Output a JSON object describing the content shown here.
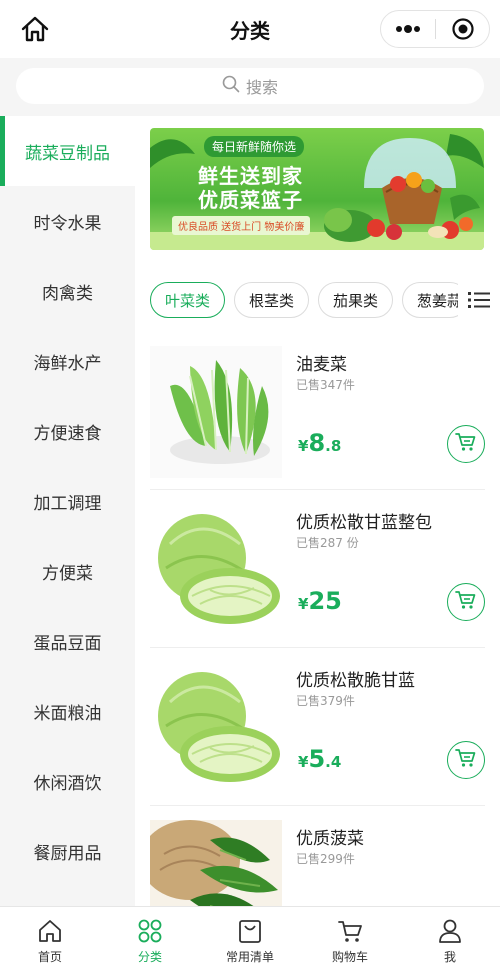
{
  "header": {
    "title": "分类"
  },
  "search": {
    "placeholder": "搜索"
  },
  "sidebar": {
    "items": [
      {
        "label": "蔬菜豆制品",
        "active": true
      },
      {
        "label": "时令水果"
      },
      {
        "label": "肉禽类"
      },
      {
        "label": "海鲜水产"
      },
      {
        "label": "方便速食"
      },
      {
        "label": "加工调理"
      },
      {
        "label": "方便菜"
      },
      {
        "label": "蛋品豆面"
      },
      {
        "label": "米面粮油"
      },
      {
        "label": "休闲酒饮"
      },
      {
        "label": "餐厨用品"
      }
    ]
  },
  "banner": {
    "tag": "每日新鲜随你选",
    "line1": "鲜生送到家",
    "line2": "优质菜篮子",
    "strip": "优良品质 送货上门 物美价廉"
  },
  "tabs": [
    {
      "label": "叶菜类",
      "active": true
    },
    {
      "label": "根茎类"
    },
    {
      "label": "茄果类"
    },
    {
      "label": "葱姜蒜"
    }
  ],
  "products": [
    {
      "name": "油麦菜",
      "sold": "已售347件",
      "yen": "¥",
      "price_int": "8",
      "price_dec": ".8"
    },
    {
      "name": "优质松散甘蓝整包",
      "sold": "已售287 份",
      "yen": "¥",
      "price_int": "25",
      "price_dec": ""
    },
    {
      "name": "优质松散脆甘蓝",
      "sold": "已售379件",
      "yen": "¥",
      "price_int": "5",
      "price_dec": ".4"
    },
    {
      "name": "优质菠菜",
      "sold": "已售299件",
      "yen": "",
      "price_int": "",
      "price_dec": ""
    }
  ],
  "tabbar": [
    {
      "label": "首页",
      "icon": "home-icon"
    },
    {
      "label": "分类",
      "icon": "category-icon",
      "active": true
    },
    {
      "label": "常用清单",
      "icon": "shopping-bag-icon"
    },
    {
      "label": "购物车",
      "icon": "cart-icon"
    },
    {
      "label": "我",
      "icon": "user-icon"
    }
  ],
  "colors": {
    "accent": "#1aad5b",
    "background": "#f5f5f5"
  }
}
